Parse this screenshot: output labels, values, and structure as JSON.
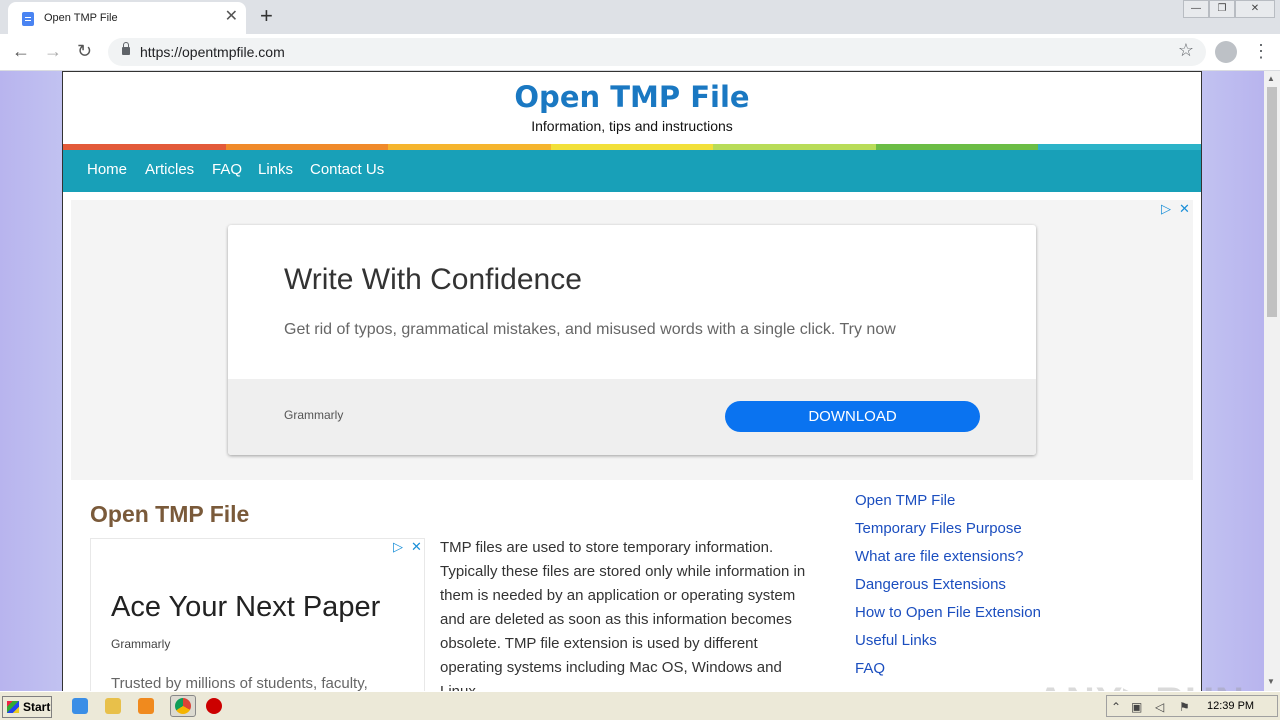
{
  "browser": {
    "tab_title": "Open TMP File",
    "tab_close": "✕",
    "new_tab": "+",
    "back": "←",
    "forward": "→",
    "reload": "↻",
    "url": "https://opentmpfile.com",
    "bookmark": "☆",
    "menu": "⋮",
    "window_controls": [
      "—",
      "❐",
      "✕"
    ]
  },
  "site": {
    "title": "Open TMP File",
    "tagline": "Information, tips and instructions",
    "rainbow_colors": [
      "#e35a3a",
      "#f08a2a",
      "#f5b52e",
      "#f2e03a",
      "#b8dc58",
      "#6bbd45",
      "#2bb3c8"
    ],
    "nav": [
      "Home",
      "Articles",
      "FAQ",
      "Links",
      "Contact Us"
    ]
  },
  "ad_top": {
    "choices_icon": "▷",
    "close_icon": "✕",
    "headline": "Write With Confidence",
    "description": "Get rid of typos, grammatical mistakes, and misused words with a single click. Try now",
    "advertiser": "Grammarly",
    "button": "DOWNLOAD"
  },
  "main": {
    "section_title": "Open TMP File",
    "ad_side": {
      "choices_icon": "▷",
      "close_icon": "✕",
      "headline": "Ace Your Next Paper",
      "advertiser": "Grammarly",
      "description": "Trusted by millions of students, faculty,"
    },
    "article_text": "TMP files are used to store temporary information. Typically these files are stored only while information in them is needed by an application or operating system and are deleted as soon as this information becomes obsolete. TMP file extension is used by different operating systems including Mac OS, Windows and Linux."
  },
  "sidebar_links": [
    "Open TMP File",
    "Temporary Files Purpose",
    "What are file extensions?",
    "Dangerous Extensions",
    "How to Open File Extension",
    "Useful Links",
    "FAQ"
  ],
  "watermark": "ANY▷RUN",
  "taskbar": {
    "start": "Start",
    "clock": "12:39 PM"
  },
  "colors": {
    "accent_blue": "#1a78c2",
    "nav_teal": "#18a0b8",
    "link_blue": "#1b4ebf",
    "download_blue": "#0a73f0"
  }
}
